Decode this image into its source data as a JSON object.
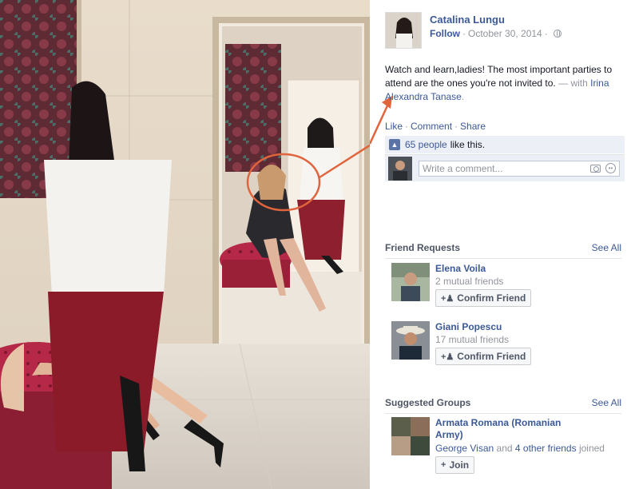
{
  "photo": {
    "alt_subject": "photo",
    "accent_color": "#e0643c"
  },
  "post": {
    "author_name": "Catalina Lungu",
    "follow_label": "Follow",
    "date": "October 30, 2014",
    "privacy_icon": "globe-icon",
    "caption_text": "Watch and learn,ladies! The most important parties to attend are the ones you're not invited to.",
    "with_prefix": "— with",
    "tagged_name": "Irina Alexandra Tanase",
    "tagged_suffix": ".",
    "actions": {
      "like": "Like",
      "comment": "Comment",
      "share": "Share"
    },
    "likes": {
      "people": "65 people",
      "suffix": "like this."
    },
    "comment_placeholder": "Write a comment..."
  },
  "friend_requests": {
    "title": "Friend Requests",
    "see_all": "See All",
    "items": [
      {
        "name": "Elena Voila",
        "mutual": "2 mutual friends",
        "button": "Confirm Friend"
      },
      {
        "name": "Giani Popescu",
        "mutual": "17 mutual friends",
        "button": "Confirm Friend"
      }
    ]
  },
  "suggested_groups": {
    "title": "Suggested Groups",
    "see_all": "See All",
    "items": [
      {
        "name": "Armata Romana (Romanian Army)",
        "member_name": "George Visan",
        "connector": "and",
        "others": "4 other friends",
        "joined": "joined",
        "button": "Join"
      }
    ]
  },
  "colors": {
    "link": "#3b5998",
    "muted": "#90949c",
    "annotation": "#e0643c"
  }
}
